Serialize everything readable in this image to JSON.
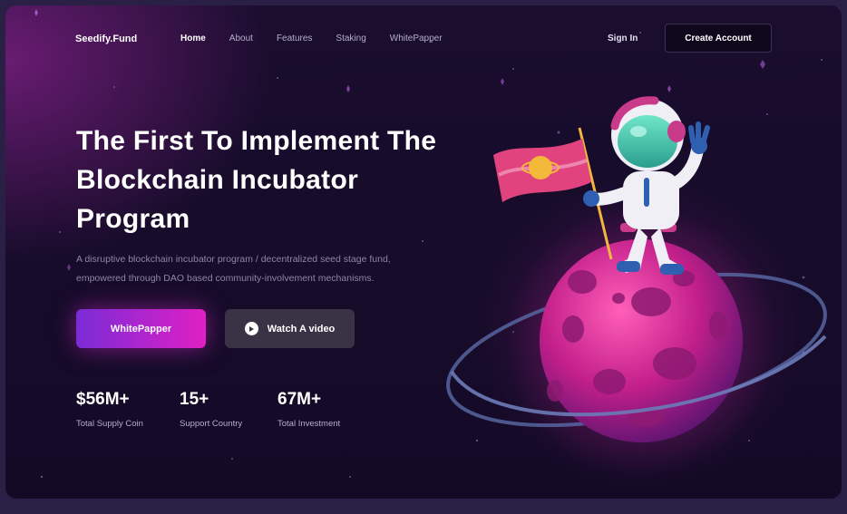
{
  "brand": "Seedify.Fund",
  "nav": {
    "links": [
      "Home",
      "About",
      "Features",
      "Staking",
      "WhitePapper"
    ],
    "active": "Home",
    "signin": "Sign In",
    "create_account": "Create Account"
  },
  "hero": {
    "title_lines": [
      "The First To Implement The",
      "Blockchain Incubator",
      "Program"
    ],
    "description_lines": [
      "A disruptive blockchain incubator program / decentralized seed stage fund,",
      "empowered through DAO based community-involvement mechanisms."
    ],
    "primary_button": "WhitePapper",
    "secondary_button": "Watch A video"
  },
  "stats": [
    {
      "value": "$56M+",
      "label": "Total Supply Coin"
    },
    {
      "value": "15+",
      "label": "Support Country"
    },
    {
      "value": "67M+",
      "label": "Total Investment"
    }
  ],
  "icons": {
    "play": "play-icon",
    "illustration": "astronaut-planet-illustration"
  },
  "colors": {
    "background": "#140a26",
    "accent_start": "#7a2bd6",
    "accent_end": "#e020c4",
    "planet": "#d82a9a"
  }
}
